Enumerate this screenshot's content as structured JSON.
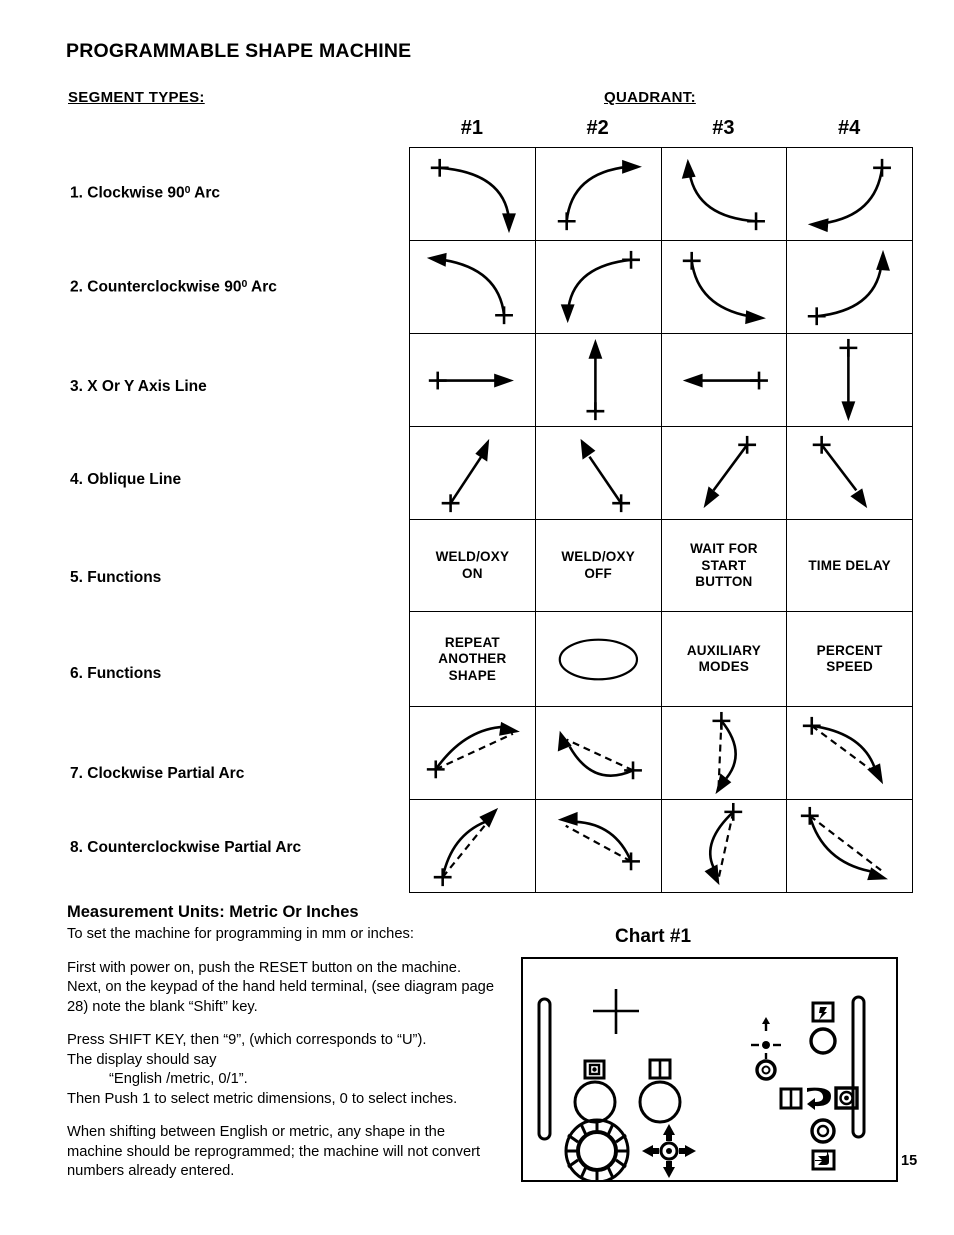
{
  "page": {
    "title": "PROGRAMMABLE SHAPE MACHINE",
    "page_number": "15",
    "segment_types_heading": "SEGMENT  TYPES:",
    "quadrant_heading": "QUADRANT:",
    "chart_caption": "Chart #1"
  },
  "quadrant_headers": [
    "#1",
    "#2",
    "#3",
    "#4"
  ],
  "segment_types": [
    {
      "number": "1.",
      "label": "Clockwise 90",
      "degree": "0",
      "suffix": " Arc",
      "full": "1. Clockwise 90⁰ Arc"
    },
    {
      "number": "2.",
      "label": "Counterclockwise 90",
      "degree": "0",
      "suffix": " Arc",
      "full": "2. Counterclockwise 90⁰ Arc"
    },
    {
      "number": "3.",
      "label": "X Or Y Axis Line",
      "degree": "",
      "suffix": "",
      "full": "3. X Or Y Axis Line"
    },
    {
      "number": "4.",
      "label": "Oblique Line",
      "degree": "",
      "suffix": "",
      "full": "4. Oblique Line"
    },
    {
      "number": "5.",
      "label": "Functions",
      "degree": "",
      "suffix": "",
      "full": "5. Functions"
    },
    {
      "number": "6.",
      "label": "Functions",
      "degree": "",
      "suffix": "",
      "full": "6. Functions"
    },
    {
      "number": "7.",
      "label": "Clockwise Partial Arc",
      "degree": "",
      "suffix": "",
      "full": "7. Clockwise Partial Arc"
    },
    {
      "number": "8.",
      "label": "Counterclockwise Partial Arc",
      "degree": "",
      "suffix": "",
      "full": "8. Counterclockwise Partial Arc"
    }
  ],
  "chart_data": {
    "type": "table",
    "title": "Chart #1",
    "columns": [
      "#1",
      "#2",
      "#3",
      "#4"
    ],
    "rows": [
      {
        "row": 1,
        "segment": "Clockwise 90⁰ Arc",
        "kind": "arc",
        "cells": [
          {
            "quadrant": "#1",
            "glyph": "arc-cw-q1",
            "start": "top-left",
            "end": "bottom-right",
            "direction": "clockwise"
          },
          {
            "quadrant": "#2",
            "glyph": "arc-cw-q2",
            "start": "bottom-left",
            "end": "top-right",
            "direction": "clockwise"
          },
          {
            "quadrant": "#3",
            "glyph": "arc-cw-q3",
            "start": "bottom-right",
            "end": "top-left",
            "direction": "clockwise"
          },
          {
            "quadrant": "#4",
            "glyph": "arc-cw-q4",
            "start": "top-right",
            "end": "bottom-left",
            "direction": "clockwise"
          }
        ]
      },
      {
        "row": 2,
        "segment": "Counterclockwise 90⁰ Arc",
        "kind": "arc",
        "cells": [
          {
            "quadrant": "#1",
            "glyph": "arc-ccw-q1",
            "start": "bottom-right",
            "end": "top-left",
            "direction": "counterclockwise"
          },
          {
            "quadrant": "#2",
            "glyph": "arc-ccw-q2",
            "start": "top-right",
            "end": "bottom-left",
            "direction": "counterclockwise"
          },
          {
            "quadrant": "#3",
            "glyph": "arc-ccw-q3",
            "start": "top-left",
            "end": "bottom-right",
            "direction": "counterclockwise"
          },
          {
            "quadrant": "#4",
            "glyph": "arc-ccw-q4",
            "start": "bottom-left",
            "end": "top-right",
            "direction": "counterclockwise"
          }
        ]
      },
      {
        "row": 3,
        "segment": "X Or Y Axis Line",
        "kind": "line",
        "cells": [
          {
            "quadrant": "#1",
            "glyph": "line-right",
            "start": "left",
            "end": "right",
            "direction": "+X right"
          },
          {
            "quadrant": "#2",
            "glyph": "line-up",
            "start": "bottom",
            "end": "top",
            "direction": "+Y up"
          },
          {
            "quadrant": "#3",
            "glyph": "line-left",
            "start": "right",
            "end": "left",
            "direction": "-X left"
          },
          {
            "quadrant": "#4",
            "glyph": "line-down",
            "start": "top",
            "end": "bottom",
            "direction": "-Y down"
          }
        ]
      },
      {
        "row": 4,
        "segment": "Oblique Line",
        "kind": "line",
        "cells": [
          {
            "quadrant": "#1",
            "glyph": "oblique-up-right",
            "start": "bottom-left",
            "end": "top-right",
            "direction": "up-right"
          },
          {
            "quadrant": "#2",
            "glyph": "oblique-up-left",
            "start": "bottom-right",
            "end": "top-left",
            "direction": "up-left"
          },
          {
            "quadrant": "#3",
            "glyph": "oblique-down-left",
            "start": "top-right",
            "end": "bottom-left",
            "direction": "down-left"
          },
          {
            "quadrant": "#4",
            "glyph": "oblique-down-right",
            "start": "top-left",
            "end": "bottom-right",
            "direction": "down-right"
          }
        ]
      },
      {
        "row": 5,
        "segment": "Functions",
        "kind": "text",
        "cells": [
          {
            "quadrant": "#1",
            "text": "WELD/OXY\nON"
          },
          {
            "quadrant": "#2",
            "text": "WELD/OXY\nOFF"
          },
          {
            "quadrant": "#3",
            "text": "WAIT FOR\nSTART\nBUTTON"
          },
          {
            "quadrant": "#4",
            "text": "TIME DELAY"
          }
        ]
      },
      {
        "row": 6,
        "segment": "Functions",
        "kind": "text",
        "cells": [
          {
            "quadrant": "#1",
            "text": "REPEAT\nANOTHER\nSHAPE"
          },
          {
            "quadrant": "#2",
            "text": "",
            "glyph": "ellipse-blank"
          },
          {
            "quadrant": "#3",
            "text": "AUXILIARY\nMODES"
          },
          {
            "quadrant": "#4",
            "text": "PERCENT\nSPEED"
          }
        ]
      },
      {
        "row": 7,
        "segment": "Clockwise Partial Arc",
        "kind": "partial-arc",
        "cells": [
          {
            "quadrant": "#1",
            "glyph": "partial-cw-q1",
            "start": "bottom-left",
            "end": "top-right",
            "direction": "clockwise",
            "chord": "dashed"
          },
          {
            "quadrant": "#2",
            "glyph": "partial-cw-q2",
            "start": "bottom-right",
            "end": "top-left",
            "direction": "clockwise",
            "chord": "dashed"
          },
          {
            "quadrant": "#3",
            "glyph": "partial-cw-q3",
            "start": "top",
            "end": "bottom",
            "direction": "clockwise",
            "chord": "dashed"
          },
          {
            "quadrant": "#4",
            "glyph": "partial-cw-q4",
            "start": "top-left",
            "end": "bottom-right",
            "direction": "clockwise",
            "chord": "dashed"
          }
        ]
      },
      {
        "row": 8,
        "segment": "Counterclockwise Partial Arc",
        "kind": "partial-arc",
        "cells": [
          {
            "quadrant": "#1",
            "glyph": "partial-ccw-q1",
            "start": "bottom-left",
            "end": "top-right",
            "direction": "counterclockwise",
            "chord": "dashed"
          },
          {
            "quadrant": "#2",
            "glyph": "partial-ccw-q2",
            "start": "bottom-right",
            "end": "top-left",
            "direction": "counterclockwise",
            "chord": "dashed"
          },
          {
            "quadrant": "#3",
            "glyph": "partial-ccw-q3",
            "start": "top",
            "end": "bottom",
            "direction": "counterclockwise",
            "chord": "dashed"
          },
          {
            "quadrant": "#4",
            "glyph": "partial-ccw-q4",
            "start": "top-left",
            "end": "bottom-right",
            "direction": "counterclockwise",
            "chord": "dashed"
          }
        ]
      }
    ]
  },
  "measurement": {
    "heading": "Measurement Units: Metric Or Inches",
    "intro": "To set the machine for programming in mm or inches:",
    "para1": "First with power on, push the RESET button on the machine. Next, on the keypad of the hand held terminal, (see diagram page 28) note the blank “Shift” key.",
    "para2_line1": "Press SHIFT KEY, then “9”, (which corresponds to “U”).",
    "para2_line2": "The display should say",
    "para2_line3": "“English /metric, 0/1”.",
    "para2_line4": "Then Push 1 to select metric dimensions, 0 to select inches.",
    "para3": "When shifting between English or metric, any shape in the machine should be reprogrammed; the machine will not convert numbers already entered."
  },
  "control_panel": {
    "name": "machine-control-panel",
    "elements": [
      {
        "icon": "crosshair-marker",
        "position": "left-upper"
      },
      {
        "icon": "vertical-slot-left",
        "position": "far-left"
      },
      {
        "icon": "vertical-slot-right",
        "position": "far-right"
      },
      {
        "icon": "square-target-button",
        "position": "left-mid"
      },
      {
        "icon": "round-button-left",
        "position": "left-mid"
      },
      {
        "icon": "split-square-button",
        "position": "left-mid-right"
      },
      {
        "icon": "round-button-center",
        "position": "left-mid-right"
      },
      {
        "icon": "knurled-rotary-dial",
        "position": "left-lower"
      },
      {
        "icon": "four-way-joypad",
        "position": "left-lower-right"
      },
      {
        "icon": "crosshair-dashed-marker",
        "position": "right-upper"
      },
      {
        "icon": "ring-button-upper",
        "position": "right-upper"
      },
      {
        "icon": "flag-square-icon",
        "position": "right-top"
      },
      {
        "icon": "round-button-right-top",
        "position": "right-top"
      },
      {
        "icon": "split-square-icon-right",
        "position": "right-mid"
      },
      {
        "icon": "hook-arrow-icon",
        "position": "right-mid"
      },
      {
        "icon": "square-target-icon-right",
        "position": "right-mid"
      },
      {
        "icon": "ring-button-lower",
        "position": "right-lower"
      },
      {
        "icon": "return-arrow-square-icon",
        "position": "right-bottom"
      }
    ]
  },
  "colors": {
    "ink": "#000000",
    "paper": "#ffffff"
  }
}
